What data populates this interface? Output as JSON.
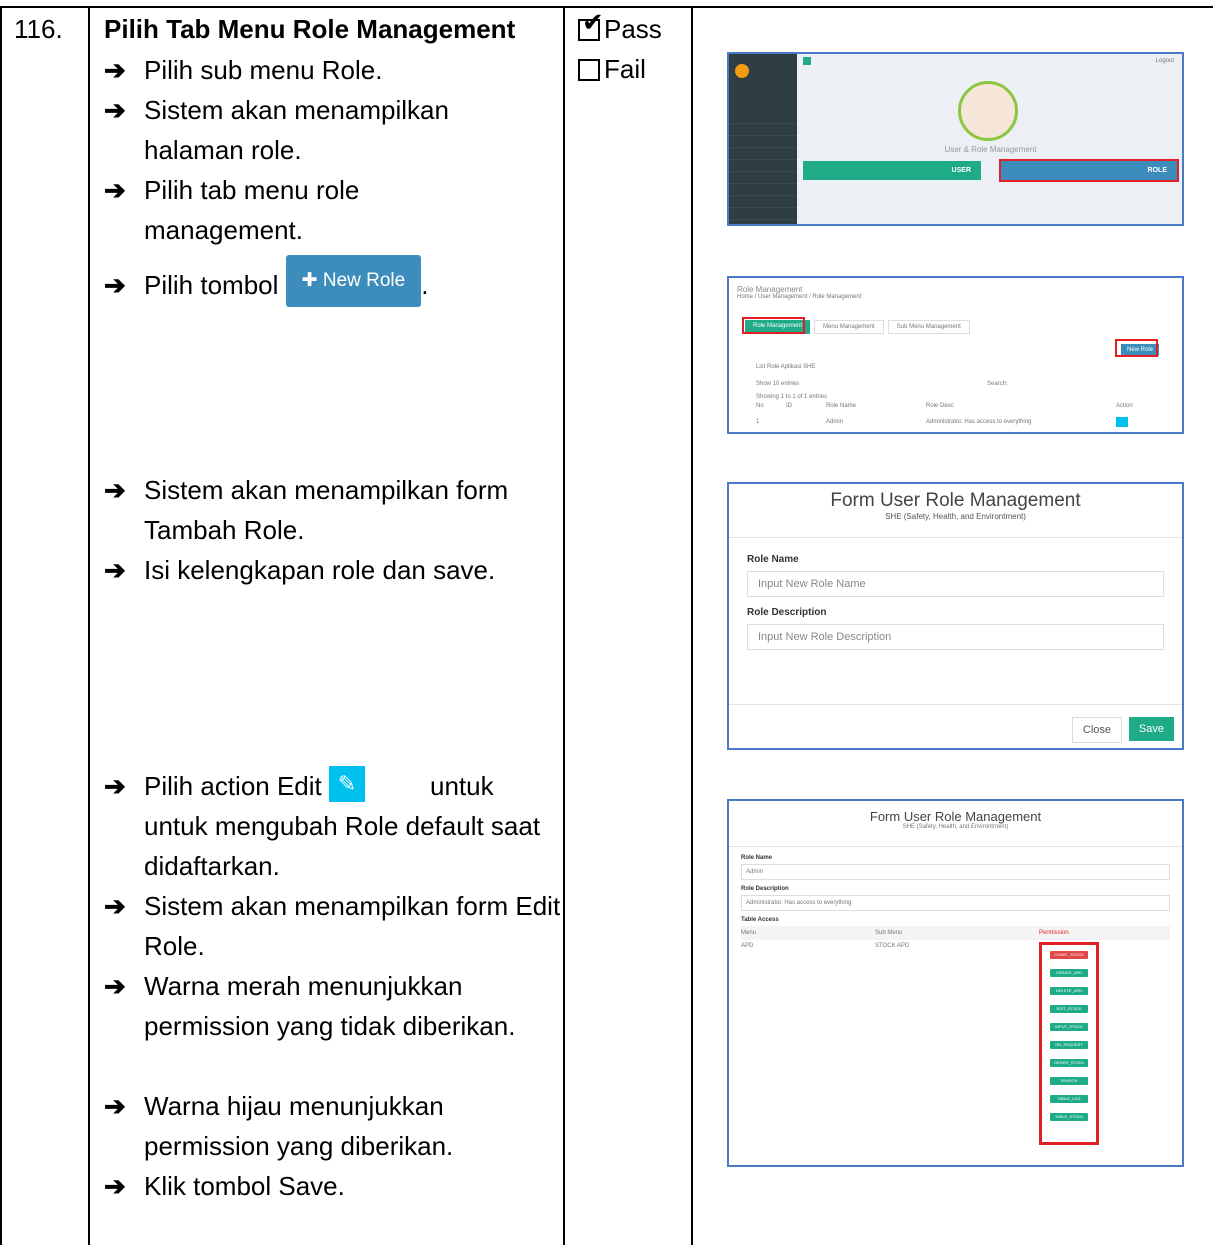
{
  "row": {
    "number": "116.",
    "title": "Pilih Tab Menu Role Management",
    "steps": [
      "Pilih sub menu Role.",
      "Sistem akan menampilkan halaman role.",
      "Pilih tab menu role management.",
      "Pilih tombol",
      "Sistem akan menampilkan form Tambah Role.",
      "Isi kelengkapan role dan save.",
      "Pilih action Edit",
      "untuk mengubah Role default saat didaftarkan.",
      "Sistem akan menampilkan form Edit Role.",
      "Warna merah menunjukkan permission yang tidak diberikan.",
      "Warna hijau menunjukkan permission yang diberikan.",
      "Klik tombol Save."
    ],
    "new_role_button": "New Role",
    "status": {
      "pass": "Pass",
      "fail": "Fail"
    }
  },
  "screenshots": {
    "shot1": {
      "title": "User & Role Management",
      "user": "USER",
      "role": "ROLE",
      "logout": "Logout"
    },
    "shot2": {
      "title": "Role Management",
      "breadcrumb": "Home / User Management / Role Management",
      "tabs": [
        "Role Management",
        "Menu Management",
        "Sub Menu Management"
      ],
      "new_role": "New Role",
      "list_title": "List Role Aplikasi SHE",
      "show": "Show 10 entries",
      "search": "Search:",
      "showing": "Showing 1 to 1 of 1 entries",
      "columns": [
        "No",
        "ID",
        "Role Name",
        "Role Desc",
        "Action"
      ],
      "row": [
        "1",
        "",
        "Admin",
        "Administrator. Has access to everything"
      ]
    },
    "shot3": {
      "title": "Form User Role Management",
      "subtitle": "SHE (Safety, Health, and Environtment)",
      "role_name_label": "Role Name",
      "role_name_placeholder": "Input New Role Name",
      "role_desc_label": "Role Description",
      "role_desc_placeholder": "Input New Role Description",
      "close": "Close",
      "save": "Save"
    },
    "shot4": {
      "title": "Form User Role Management",
      "subtitle": "SHE (Safety, Health, and Environtment)",
      "role_name_label": "Role Name",
      "role_name_value": "Admin",
      "role_desc_label": "Role Description",
      "role_desc_value": "Administrator. Has access to everything",
      "table_access": "Table Access",
      "columns": [
        "Menu",
        "Sub Menu",
        "Permission"
      ],
      "menu": "APD",
      "sub_menu": "STOCK APD",
      "permissions": [
        "CHART_STOCK",
        "CREATE_APD",
        "DELETE_APD",
        "EDIT_STOCK",
        "INPUT_STOCK",
        "ON_REQUEST",
        "ORDER_STOCK",
        "SEARCH",
        "TABLE_LOG",
        "TABLE_STOCK"
      ]
    }
  }
}
